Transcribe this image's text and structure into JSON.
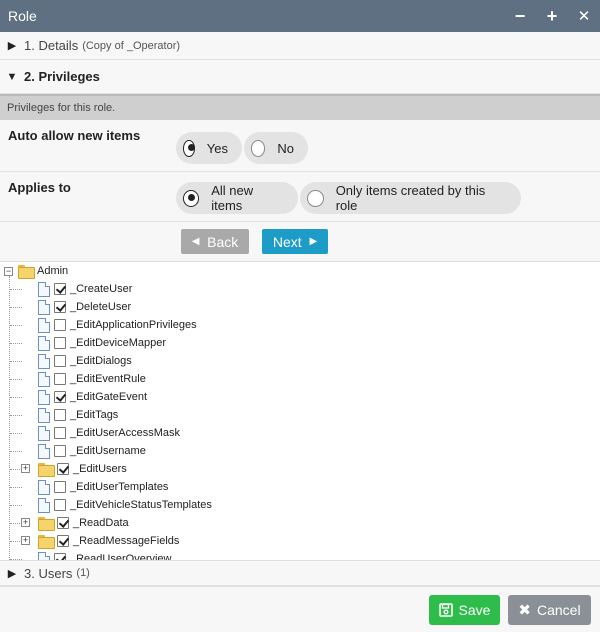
{
  "window": {
    "title": "Role",
    "controls": {
      "minimize": "−",
      "maximize": "+",
      "close": "✕"
    }
  },
  "sections": {
    "details": {
      "title": "1. Details",
      "subtitle": "(Copy of _Operator)",
      "expanded": false
    },
    "privileges": {
      "title": "2. Privileges",
      "expanded": true
    },
    "users": {
      "title": "3. Users",
      "count": "(1)",
      "expanded": false
    }
  },
  "privileges": {
    "info": "Privileges for this role.",
    "auto_allow": {
      "label": "Auto allow new items",
      "options": [
        {
          "label": "Yes",
          "selected": true
        },
        {
          "label": "No",
          "selected": false
        }
      ]
    },
    "applies_to": {
      "label": "Applies to",
      "options": [
        {
          "label": "All new items",
          "selected": true
        },
        {
          "label": "Only items created by this role",
          "selected": false
        }
      ]
    },
    "nav": {
      "back_label": "Back",
      "next_label": "Next"
    }
  },
  "tree": {
    "root": {
      "label": "Admin",
      "expanded": true
    },
    "items": [
      {
        "label": "_CreateUser",
        "type": "doc",
        "checked": true,
        "expandable": false
      },
      {
        "label": "_DeleteUser",
        "type": "doc",
        "checked": true,
        "expandable": false
      },
      {
        "label": "_EditApplicationPrivileges",
        "type": "doc",
        "checked": false,
        "expandable": false
      },
      {
        "label": "_EditDeviceMapper",
        "type": "doc",
        "checked": false,
        "expandable": false
      },
      {
        "label": "_EditDialogs",
        "type": "doc",
        "checked": false,
        "expandable": false
      },
      {
        "label": "_EditEventRule",
        "type": "doc",
        "checked": false,
        "expandable": false
      },
      {
        "label": "_EditGateEvent",
        "type": "doc",
        "checked": true,
        "expandable": false
      },
      {
        "label": "_EditTags",
        "type": "doc",
        "checked": false,
        "expandable": false
      },
      {
        "label": "_EditUserAccessMask",
        "type": "doc",
        "checked": false,
        "expandable": false
      },
      {
        "label": "_EditUsername",
        "type": "doc",
        "checked": false,
        "expandable": false
      },
      {
        "label": "_EditUsers",
        "type": "folder",
        "checked": true,
        "expandable": true
      },
      {
        "label": "_EditUserTemplates",
        "type": "doc",
        "checked": false,
        "expandable": false
      },
      {
        "label": "_EditVehicleStatusTemplates",
        "type": "doc",
        "checked": false,
        "expandable": false
      },
      {
        "label": "_ReadData",
        "type": "folder",
        "checked": true,
        "expandable": true
      },
      {
        "label": "_ReadMessageFields",
        "type": "folder",
        "checked": true,
        "expandable": true
      },
      {
        "label": "_ReadUserOverview",
        "type": "doc",
        "checked": true,
        "expandable": false
      }
    ]
  },
  "footer": {
    "save_label": "Save",
    "cancel_label": "Cancel"
  },
  "colors": {
    "titlebar": "#5f7083",
    "next_button": "#1d9cc7",
    "back_button": "#a9a9a9",
    "save_button": "#2ebd4a",
    "cancel_button": "#8a9096"
  },
  "icons": {
    "collapsed": "triangle-right-icon",
    "expanded": "triangle-down-icon",
    "save": "floppy-disk-icon",
    "cancel": "x-icon"
  }
}
